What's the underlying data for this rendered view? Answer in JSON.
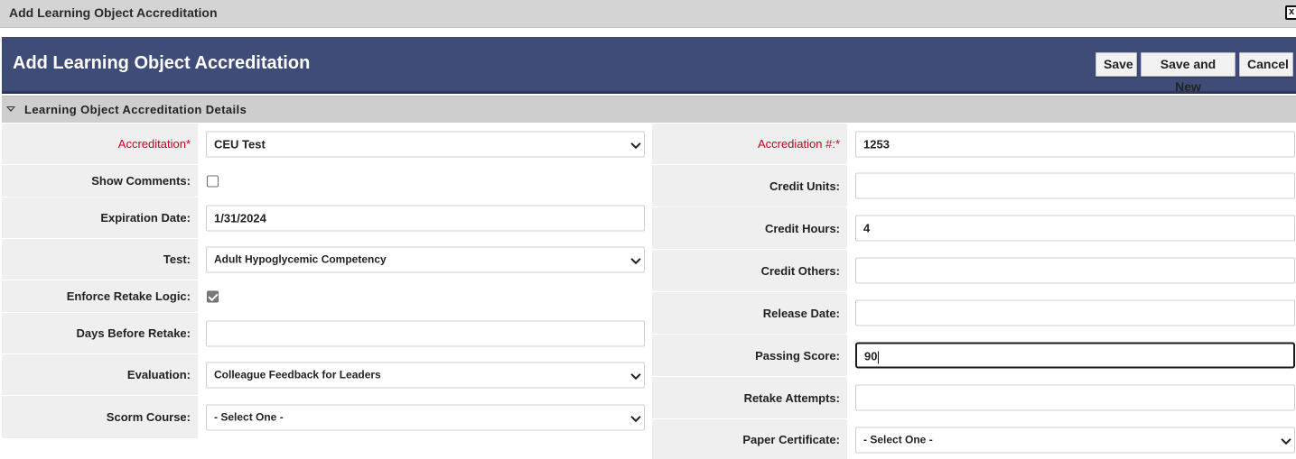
{
  "window": {
    "title": "Add Learning Object Accreditation",
    "close_glyph": "x"
  },
  "header": {
    "title": "Add Learning Object Accreditation"
  },
  "toolbar": {
    "save_label": "Save",
    "save_new_label": "Save and New",
    "cancel_label": "Cancel"
  },
  "section": {
    "title": "Learning Object Accreditation Details"
  },
  "left": {
    "accreditation": {
      "label": "Accreditation",
      "required": "*",
      "value": "CEU Test"
    },
    "show_comments": {
      "label": "Show Comments:",
      "checked": false
    },
    "expiration_date": {
      "label": "Expiration Date:",
      "value": "1/31/2024"
    },
    "test": {
      "label": "Test:",
      "value": "Adult Hypoglycemic Competency"
    },
    "enforce_retake": {
      "label": "Enforce Retake Logic:",
      "checked": true
    },
    "days_before_retake": {
      "label": "Days Before Retake:",
      "value": ""
    },
    "evaluation": {
      "label": "Evaluation:",
      "value": "Colleague Feedback for Leaders"
    },
    "scorm_course": {
      "label": "Scorm Course:",
      "value": "- Select One -"
    }
  },
  "right": {
    "accreditation_number": {
      "label": "Accrediation #:",
      "required": "*",
      "value": "1253"
    },
    "credit_units": {
      "label": "Credit Units:",
      "value": ""
    },
    "credit_hours": {
      "label": "Credit Hours:",
      "value": "4"
    },
    "credit_others": {
      "label": "Credit Others:",
      "value": ""
    },
    "release_date": {
      "label": "Release Date:",
      "value": ""
    },
    "passing_score": {
      "label": "Passing Score:",
      "value": "90"
    },
    "retake_attempts": {
      "label": "Retake Attempts:",
      "value": ""
    },
    "paper_certificate": {
      "label": "Paper Certificate:",
      "value": "- Select One -"
    }
  },
  "colors": {
    "header_bg": "#3f4c78",
    "required": "#c8001f",
    "label_bg": "#efefef",
    "titlebar_bg": "#d4d4d4",
    "section_bg": "#cfcece"
  }
}
